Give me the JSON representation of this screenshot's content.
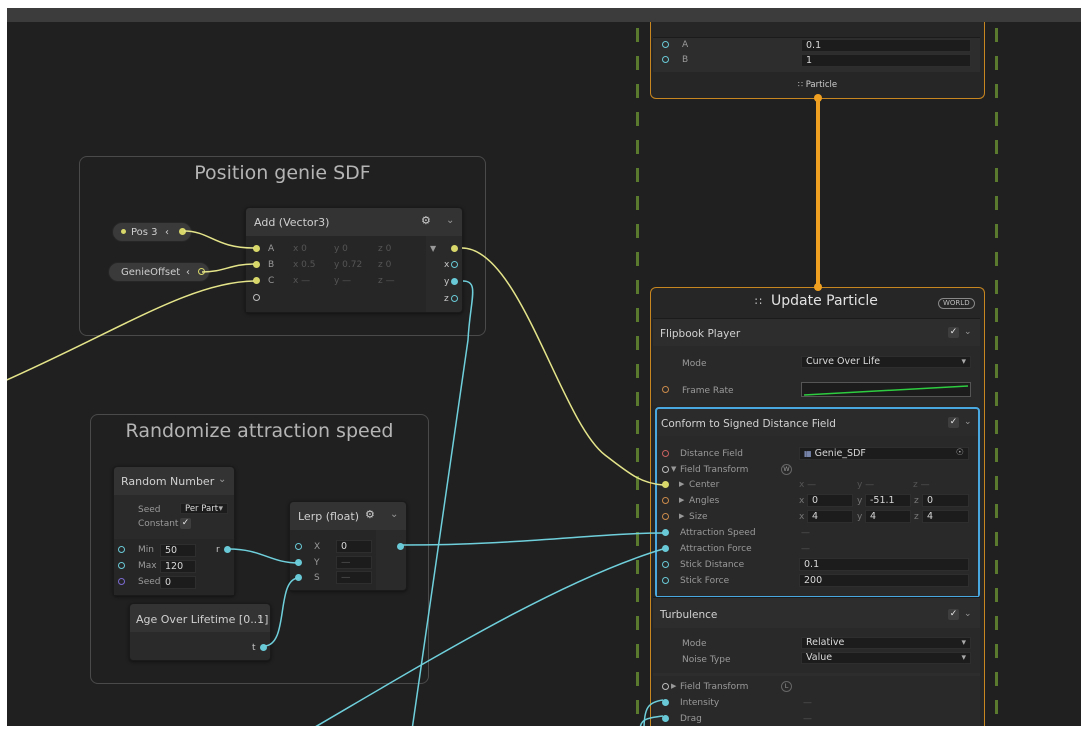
{
  "groups": {
    "position": {
      "title": "Position genie SDF"
    },
    "randomize": {
      "title": "Randomize attraction speed"
    }
  },
  "properties": {
    "pos3": "Pos 3",
    "genie_offset": "GenieOffset"
  },
  "add_node": {
    "title": "Add (Vector3)",
    "rows": [
      {
        "label": "A",
        "x": "x 0",
        "y": "y 0",
        "z": "z 0"
      },
      {
        "label": "B",
        "x": "x 0.5",
        "y": "y 0.72",
        "z": "z 0"
      },
      {
        "label": "C",
        "x": "x —",
        "y": "y —",
        "z": "z —"
      }
    ],
    "outputs": [
      "x",
      "y",
      "z"
    ]
  },
  "random_node": {
    "title": "Random Number",
    "seed_label": "Seed",
    "seed_value": "Per Part",
    "constant_label": "Constant",
    "min_label": "Min",
    "min_value": "50",
    "max_label": "Max",
    "max_value": "120",
    "seedin_label": "Seed",
    "seedin_value": "0",
    "out": "r"
  },
  "lerp_node": {
    "title": "Lerp (float)",
    "x_label": "X",
    "x_value": "0",
    "y_label": "Y",
    "y_value": "—",
    "s_label": "S",
    "s_value": "—"
  },
  "age_node": {
    "title": "Age Over Lifetime [0..1]",
    "out": "t"
  },
  "top_context": {
    "a_label": "A",
    "a_value": "0.1",
    "b_label": "B",
    "b_value": "1",
    "footer": "Particle"
  },
  "update_context": {
    "title": "Update Particle",
    "badge": "WORLD",
    "flipbook": {
      "title": "Flipbook Player",
      "mode_label": "Mode",
      "mode_value": "Curve Over Life",
      "framerate_label": "Frame Rate"
    },
    "conform": {
      "title": "Conform to Signed Distance Field",
      "distance_field_label": "Distance Field",
      "distance_field_value": "Genie_SDF",
      "field_transform_label": "Field Transform",
      "field_transform_badge": "W",
      "center_label": "Center",
      "center_x": "x —",
      "center_y": "y —",
      "center_z": "z —",
      "angles_label": "Angles",
      "angles_x": "0",
      "angles_y": "-51.1",
      "angles_z": "0",
      "size_label": "Size",
      "size_x": "4",
      "size_y": "4",
      "size_z": "4",
      "attraction_speed_label": "Attraction Speed",
      "attraction_speed_value": "—",
      "attraction_force_label": "Attraction Force",
      "attraction_force_value": "—",
      "stick_distance_label": "Stick Distance",
      "stick_distance_value": "0.1",
      "stick_force_label": "Stick Force",
      "stick_force_value": "200"
    },
    "turbulence": {
      "title": "Turbulence",
      "mode_label": "Mode",
      "mode_value": "Relative",
      "noise_label": "Noise Type",
      "noise_value": "Value",
      "field_transform_label": "Field Transform",
      "field_transform_badge": "L",
      "intensity_label": "Intensity",
      "intensity_value": "—",
      "drag_label": "Drag",
      "drag_value": "—"
    }
  },
  "colors": {
    "position_wire": "#e4e48a",
    "float_wire": "#6fd0dc",
    "flow_wire": "#f0a020",
    "context_border": "#c7861f",
    "selection": "#4aa8e0",
    "curve": "#2ecc40"
  }
}
